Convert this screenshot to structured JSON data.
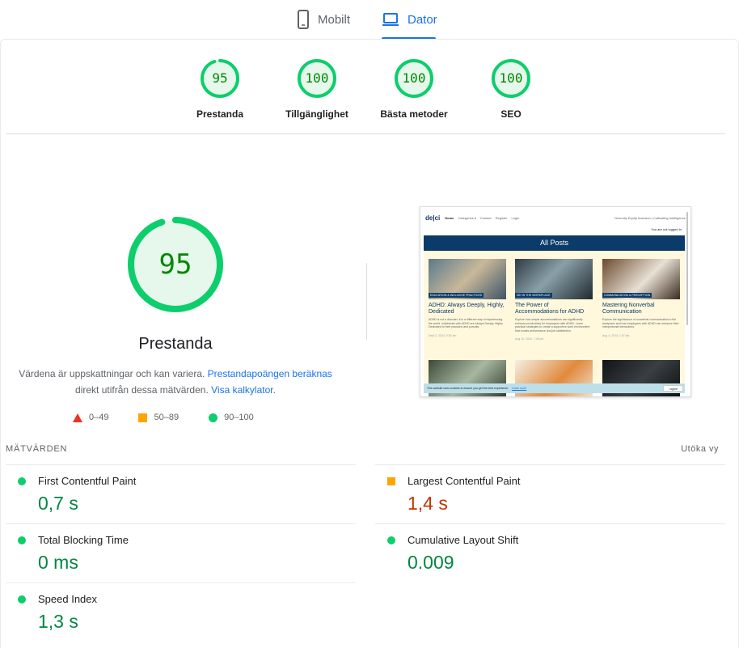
{
  "tabs": [
    {
      "label": "Mobilt",
      "icon": "smartphone-icon",
      "active": false
    },
    {
      "label": "Dator",
      "icon": "laptop-icon",
      "active": true
    }
  ],
  "categories": [
    {
      "score": "95",
      "name": "Prestanda",
      "value": 95
    },
    {
      "score": "100",
      "name": "Tillgänglighet",
      "value": 100
    },
    {
      "score": "100",
      "name": "Bästa metoder",
      "value": 100
    },
    {
      "score": "100",
      "name": "SEO",
      "value": 100
    }
  ],
  "performance": {
    "score": "95",
    "value": 95,
    "title": "Prestanda",
    "desc_prefix": "Värdena är uppskattningar och kan variera.",
    "desc_link1": "Prestandapoängen beräknas",
    "desc_middle": "direkt utifrån dessa mätvärden.",
    "desc_link2": "Visa kalkylator",
    "desc_suffix": "."
  },
  "legend": [
    {
      "range": "0–49",
      "shape": "triangle",
      "color": "#eb3223"
    },
    {
      "range": "50–89",
      "shape": "square",
      "color": "#ffa400"
    },
    {
      "range": "90–100",
      "shape": "circle",
      "color": "#0cce6b"
    }
  ],
  "screenshot": {
    "logo": "de|ci",
    "nav": [
      "Home",
      "Categories ▾",
      "Contact",
      "Register",
      "Login"
    ],
    "right_links": "Diversity Equity Inclusion | Cultivating Intelligence",
    "not_logged": "You are not logged in.",
    "banner": "All Posts",
    "cards": [
      {
        "tag": "EDUCATION & INCLUSIVE PRACTICES",
        "title": "ADHD: Always Deeply, Highly, Dedicated",
        "body": "ADHD is not a disorder; it is a different way of experiencing the world. Individuals with ADHD are Always Deeply, Highly Dedicated to their passions and pursuits.",
        "date": "Sept 2, 2024, 9:30 am"
      },
      {
        "tag": "DEI IN THE WORKPLACE",
        "title": "The Power of Accommodations for ADHD",
        "body": "Explore how simple accommodations can significantly enhance productivity for employees with ADHD. Learn practical strategies to create a supportive work environment that boosts performance and job satisfaction.",
        "date": "Aug 10, 2024, 7:45 pm"
      },
      {
        "tag": "COMMUNICATION & PERCEPTION",
        "title": "Mastering Nonverbal Communication",
        "body": "Explore the significance of nonverbal communication in the workplace and how employees with ADHD can enhance their interpersonal interactions.",
        "date": "Aug 4, 2024, 1:57 am"
      }
    ],
    "cookie_text": "This website uses cookies to ensure you get the best experience.",
    "cookie_link": "Learn more",
    "cookie_accept": "I agree"
  },
  "metrics_header": "MÄTVÄRDEN",
  "expand_label": "Utöka vy",
  "metrics": [
    {
      "name": "First Contentful Paint",
      "value": "0,7 s",
      "rating": "good"
    },
    {
      "name": "Largest Contentful Paint",
      "value": "1,4 s",
      "rating": "avg"
    },
    {
      "name": "Total Blocking Time",
      "value": "0 ms",
      "rating": "good"
    },
    {
      "name": "Cumulative Layout Shift",
      "value": "0.009",
      "rating": "good"
    },
    {
      "name": "Speed Index",
      "value": "1,3 s",
      "rating": "good"
    }
  ],
  "colors": {
    "accent": "#1a73e8",
    "pass": "#0cce6b",
    "pass_text": "#008800",
    "average": "#ffa400",
    "fail": "#eb3223"
  }
}
